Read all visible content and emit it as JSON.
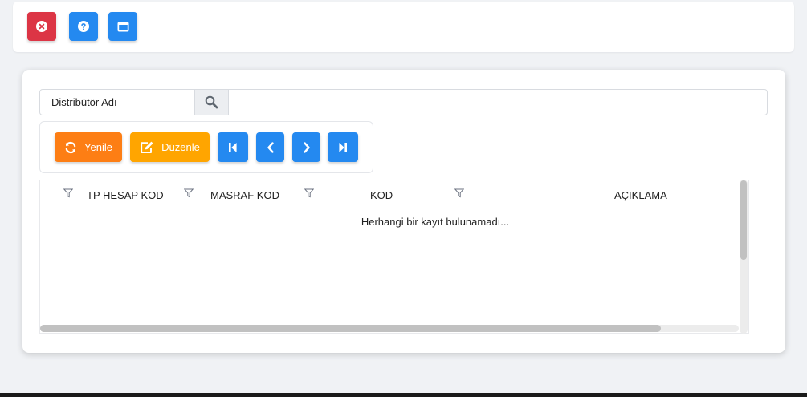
{
  "topbar": {
    "buttons": [
      {
        "name": "close",
        "icon": "close-circle-icon",
        "color": "#dc3545"
      },
      {
        "name": "help",
        "icon": "question-circle-icon",
        "color": "#2489f0"
      },
      {
        "name": "window",
        "icon": "window-icon",
        "color": "#2489f0"
      }
    ]
  },
  "search": {
    "label": "Distribütör Adı",
    "icon": "search-icon",
    "value": ""
  },
  "toolbar": {
    "refresh_label": "Yenile",
    "refresh_color": "#fd7e14",
    "edit_label": "Düzenle",
    "edit_color": "#ffa500",
    "nav_color": "#2489f0",
    "nav": [
      "first-page-icon",
      "previous-page-icon",
      "next-page-icon",
      "last-page-icon"
    ]
  },
  "grid": {
    "columns": [
      "TP HESAP KOD",
      "MASRAF KOD",
      "KOD",
      "AÇIKLAMA"
    ],
    "filter_icon": "filter-icon",
    "empty_message": "Herhangi bir kayıt bulunamadı..."
  }
}
